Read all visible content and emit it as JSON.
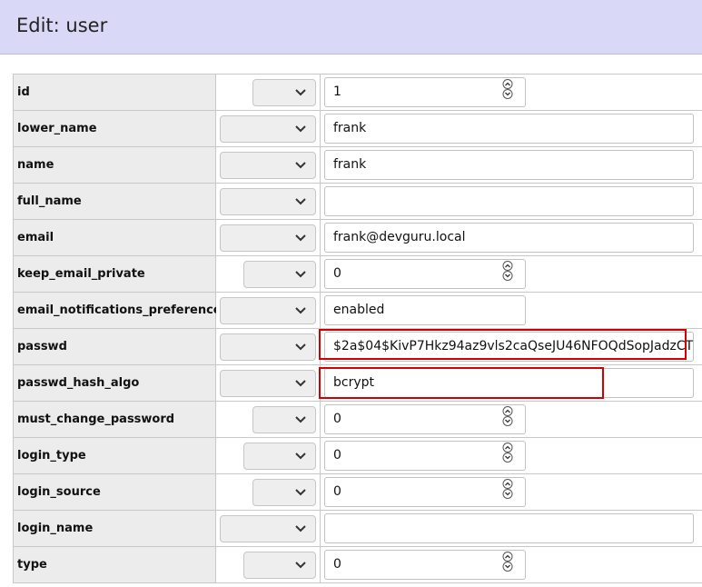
{
  "header": {
    "title": "Edit: user"
  },
  "icons": {
    "select_chevron": "chevron-down-icon",
    "spinner": "up-down-spinner-icon"
  },
  "colors": {
    "header_bg": "#d9d9f7",
    "highlight": "#d40000"
  },
  "fields": [
    {
      "key": "id",
      "label": "id",
      "value": "1",
      "input": "number"
    },
    {
      "key": "lower_name",
      "label": "lower_name",
      "value": "frank",
      "input": "text"
    },
    {
      "key": "name",
      "label": "name",
      "value": "frank",
      "input": "text"
    },
    {
      "key": "full_name",
      "label": "full_name",
      "value": "",
      "input": "text"
    },
    {
      "key": "email",
      "label": "email",
      "value": "frank@devguru.local",
      "input": "text"
    },
    {
      "key": "keep_email_private",
      "label": "keep_email_private",
      "value": "0",
      "input": "number"
    },
    {
      "key": "email_notifications_preference",
      "label": "email_notifications_preference",
      "value": "enabled",
      "input": "short"
    },
    {
      "key": "passwd",
      "label": "passwd",
      "value": "$2a$04$KivP7Hkz94az9vls2caQseJU46NFOQdSopJadzCT",
      "input": "text",
      "highlighted": true
    },
    {
      "key": "passwd_hash_algo",
      "label": "passwd_hash_algo",
      "value": "bcrypt",
      "input": "text",
      "highlighted": true
    },
    {
      "key": "must_change_password",
      "label": "must_change_password",
      "value": "0",
      "input": "number"
    },
    {
      "key": "login_type",
      "label": "login_type",
      "value": "0",
      "input": "number"
    },
    {
      "key": "login_source",
      "label": "login_source",
      "value": "0",
      "input": "number"
    },
    {
      "key": "login_name",
      "label": "login_name",
      "value": "",
      "input": "text"
    },
    {
      "key": "type",
      "label": "type",
      "value": "0",
      "input": "number"
    }
  ]
}
